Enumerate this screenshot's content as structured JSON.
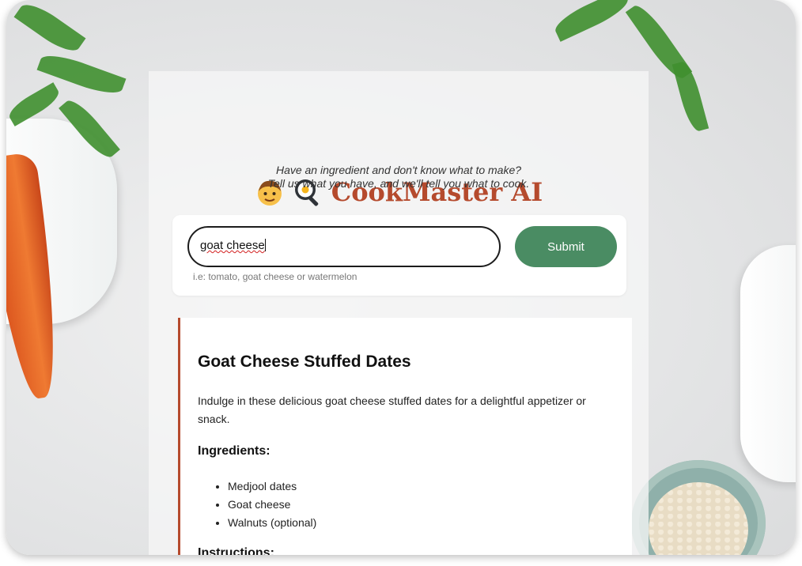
{
  "app": {
    "title": "CookMaster AI",
    "tagline_line1": "Have an ingredient and don't know what to make?",
    "tagline_line2": "Tell us what you have, and we'll tell you what to cook."
  },
  "search": {
    "value": "goat cheese",
    "hint": "i.e: tomato, goat cheese or watermelon",
    "submit_label": "Submit"
  },
  "recipe": {
    "title": "Goat Cheese Stuffed Dates",
    "description": "Indulge in these delicious goat cheese stuffed dates for a delightful appetizer or snack.",
    "ingredients_heading": "Ingredients:",
    "ingredients": [
      "Medjool dates",
      "Goat cheese",
      "Walnuts (optional)"
    ],
    "instructions_heading": "Instructions:"
  },
  "colors": {
    "brand": "#b54a2d",
    "submit": "#4a8c63"
  },
  "icons": [
    "boy-emoji-icon",
    "frying-pan-egg-icon"
  ]
}
